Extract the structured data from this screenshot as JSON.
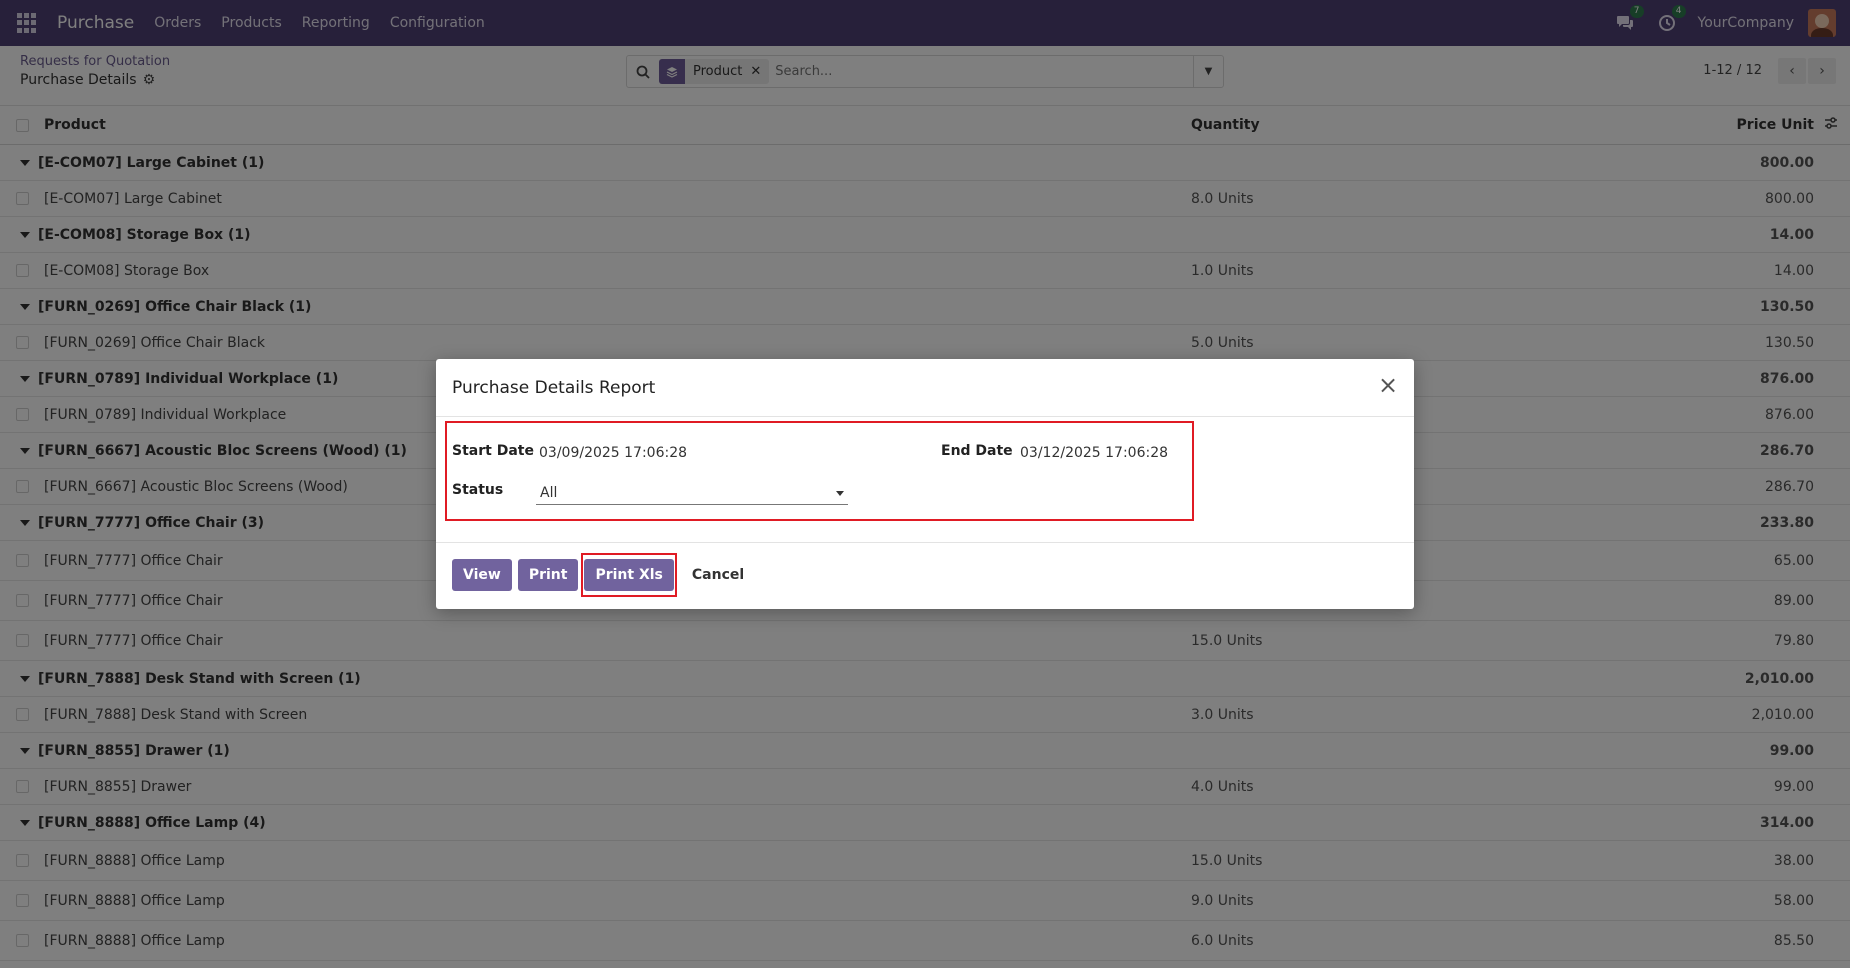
{
  "navbar": {
    "brand": "Purchase",
    "menu": [
      "Orders",
      "Products",
      "Reporting",
      "Configuration"
    ],
    "chat_badge": "7",
    "activity_badge": "4",
    "company": "YourCompany",
    "color": "#4f4175"
  },
  "control": {
    "breadcrumb": "Requests for Quotation",
    "title": "Purchase Details",
    "facet_label": "Product",
    "search_placeholder": "Search...",
    "pager": "1-12 / 12"
  },
  "list": {
    "headers": {
      "product": "Product",
      "quantity": "Quantity",
      "price": "Price Unit"
    },
    "rows": [
      {
        "type": "group",
        "product": "[E-COM07] Large Cabinet (1)",
        "qty": "",
        "price": "800.00"
      },
      {
        "type": "line",
        "product": "[E-COM07] Large Cabinet",
        "qty": "8.0 Units",
        "price": "800.00"
      },
      {
        "type": "group",
        "product": "[E-COM08] Storage Box (1)",
        "qty": "",
        "price": "14.00"
      },
      {
        "type": "line",
        "product": "[E-COM08] Storage Box",
        "qty": "1.0 Units",
        "price": "14.00"
      },
      {
        "type": "group",
        "product": "[FURN_0269] Office Chair Black (1)",
        "qty": "",
        "price": "130.50"
      },
      {
        "type": "line",
        "product": "[FURN_0269] Office Chair Black",
        "qty": "5.0 Units",
        "price": "130.50"
      },
      {
        "type": "group",
        "product": "[FURN_0789] Individual Workplace (1)",
        "qty": "",
        "price": "876.00"
      },
      {
        "type": "line",
        "product": "[FURN_0789] Individual Workplace",
        "qty": "",
        "price": "876.00"
      },
      {
        "type": "group",
        "product": "[FURN_6667] Acoustic Bloc Screens (Wood) (1)",
        "qty": "",
        "price": "286.70"
      },
      {
        "type": "line",
        "product": "[FURN_6667] Acoustic Bloc Screens (Wood)",
        "qty": "",
        "price": "286.70"
      },
      {
        "type": "group",
        "product": "[FURN_7777] Office Chair (3)",
        "qty": "",
        "price": "233.80"
      },
      {
        "type": "line",
        "product": "[FURN_7777] Office Chair",
        "qty": "",
        "price": "65.00",
        "tall": true
      },
      {
        "type": "line",
        "product": "[FURN_7777] Office Chair",
        "qty": "",
        "price": "89.00",
        "tall": true
      },
      {
        "type": "line",
        "product": "[FURN_7777] Office Chair",
        "qty": "15.0 Units",
        "price": "79.80",
        "tall": true
      },
      {
        "type": "group",
        "product": "[FURN_7888] Desk Stand with Screen (1)",
        "qty": "",
        "price": "2,010.00"
      },
      {
        "type": "line",
        "product": "[FURN_7888] Desk Stand with Screen",
        "qty": "3.0 Units",
        "price": "2,010.00"
      },
      {
        "type": "group",
        "product": "[FURN_8855] Drawer (1)",
        "qty": "",
        "price": "99.00"
      },
      {
        "type": "line",
        "product": "[FURN_8855] Drawer",
        "qty": "4.0 Units",
        "price": "99.00"
      },
      {
        "type": "group",
        "product": "[FURN_8888] Office Lamp (4)",
        "qty": "",
        "price": "314.00"
      },
      {
        "type": "line",
        "product": "[FURN_8888] Office Lamp",
        "qty": "15.0 Units",
        "price": "38.00",
        "tall": true
      },
      {
        "type": "line",
        "product": "[FURN_8888] Office Lamp",
        "qty": "9.0 Units",
        "price": "58.00",
        "tall": true
      },
      {
        "type": "line",
        "product": "[FURN_8888] Office Lamp",
        "qty": "6.0 Units",
        "price": "85.50",
        "tall": true
      }
    ]
  },
  "dialog": {
    "title": "Purchase Details Report",
    "start_date_label": "Start Date",
    "start_date_value": "03/09/2025 17:06:28",
    "end_date_label": "End Date",
    "end_date_value": "03/12/2025 17:06:28",
    "status_label": "Status",
    "status_value": "All",
    "buttons": {
      "view": "View",
      "print": "Print",
      "print_xls": "Print Xls",
      "cancel": "Cancel"
    },
    "accent": "#71639e",
    "highlight": "#e01b24"
  }
}
